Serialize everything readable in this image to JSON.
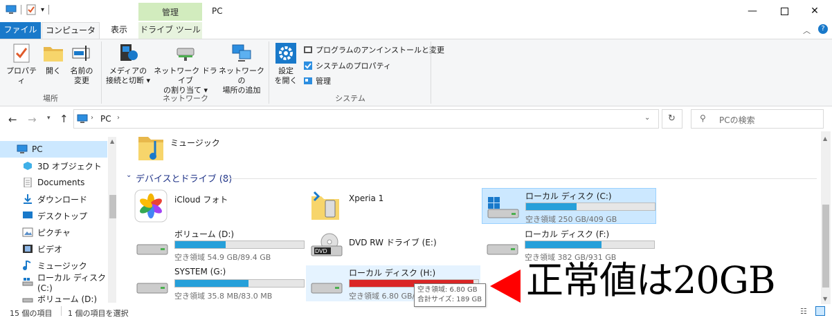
{
  "window": {
    "title": "PC",
    "context_tab_label": "管理"
  },
  "tabs": {
    "file": "ファイル",
    "computer": "コンピューター",
    "view": "表示",
    "drive_tools": "ドライブ ツール"
  },
  "ribbon": {
    "location": {
      "label": "場所",
      "properties": "プロパティ",
      "open": "開く",
      "rename": [
        "名前の",
        "変更"
      ]
    },
    "network": {
      "label": "ネットワーク",
      "media": [
        "メディアの",
        "接続と切断 ▾"
      ],
      "map_drive": [
        "ネットワーク ドライブ",
        "の割り当て ▾"
      ],
      "add_location": [
        "ネットワークの",
        "場所の追加"
      ]
    },
    "system": {
      "label": "システム",
      "settings": [
        "設定",
        "を開く"
      ],
      "uninstall": "プログラムのアンインストールと変更",
      "sys_props": "システムのプロパティ",
      "manage": "管理"
    }
  },
  "address": {
    "path_root": "PC",
    "search_placeholder": "PCの検索"
  },
  "tree": [
    {
      "label": "PC"
    },
    {
      "label": "3D オブジェクト"
    },
    {
      "label": "Documents"
    },
    {
      "label": "ダウンロード"
    },
    {
      "label": "デスクトップ"
    },
    {
      "label": "ピクチャ"
    },
    {
      "label": "ビデオ"
    },
    {
      "label": "ミュージック"
    },
    {
      "label": "ローカル ディスク (C:)"
    },
    {
      "label": "ボリューム (D:)"
    }
  ],
  "content": {
    "music_folder": "ミュージック",
    "section_header": "デバイスとドライブ (8)",
    "devices": [
      {
        "name": "iCloud フォト"
      },
      {
        "name": "Xperia 1"
      },
      {
        "name": "ローカル ディスク (C:)",
        "free": "空き領域 250 GB/409 GB",
        "used_fraction": 0.39
      },
      {
        "name": "ボリューム (D:)",
        "free": "空き領域 54.9 GB/89.4 GB",
        "used_fraction": 0.39
      },
      {
        "name": "DVD RW ドライブ (E:)"
      },
      {
        "name": "ローカル ディスク (F:)",
        "free": "空き領域 382 GB/931 GB",
        "used_fraction": 0.59
      },
      {
        "name": "SYSTEM (G:)",
        "free": "空き領域 35.8 MB/83.0 MB",
        "used_fraction": 0.57
      },
      {
        "name": "ローカル ディスク (H:)",
        "free": "空き領域 6.80 GB/1",
        "used_fraction": 0.96
      }
    ],
    "tooltip": [
      "空き領域: 6.80 GB",
      "合計サイズ: 189 GB"
    ]
  },
  "status": {
    "count": "15 個の項目",
    "selected": "1 個の項目を選択"
  },
  "annotation": "正常値は20GB",
  "colors": {
    "bar_normal": "#26a0da",
    "bar_full": "#da2626",
    "accent": "#1979ca"
  }
}
